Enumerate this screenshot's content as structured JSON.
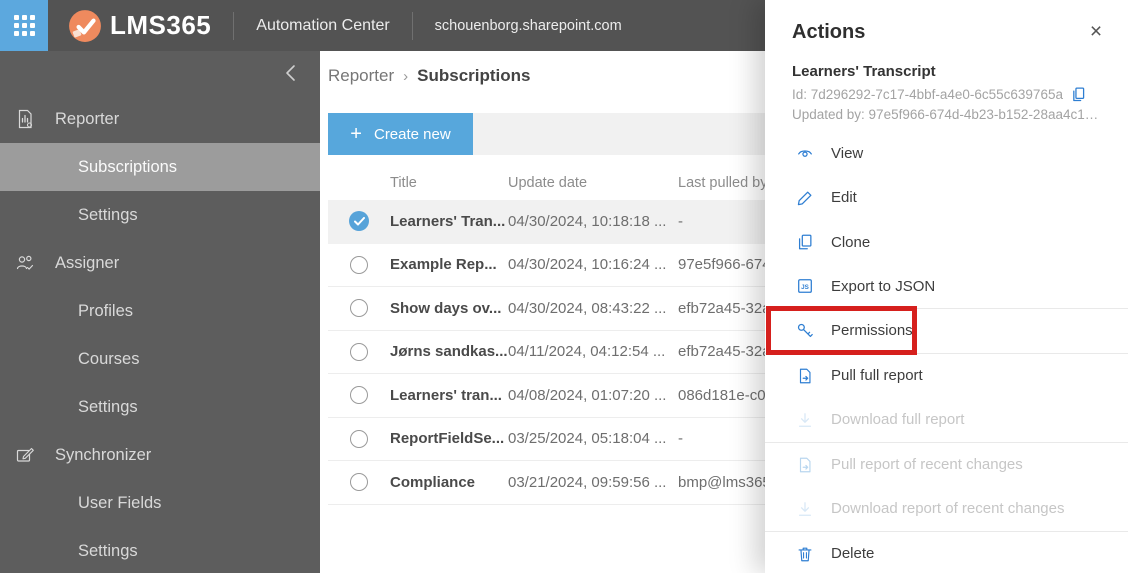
{
  "topbar": {
    "brand": "LMS365",
    "app_title": "Automation Center",
    "site_url": "schouenborg.sharepoint.com"
  },
  "sidebar": {
    "collapse_glyph": "‹",
    "items": [
      {
        "label": "Reporter",
        "type": "parent",
        "icon": "report-icon"
      },
      {
        "label": "Subscriptions",
        "type": "child",
        "selected": true
      },
      {
        "label": "Settings",
        "type": "child"
      },
      {
        "label": "Assigner",
        "type": "parent",
        "icon": "assigner-icon"
      },
      {
        "label": "Profiles",
        "type": "child"
      },
      {
        "label": "Courses",
        "type": "child"
      },
      {
        "label": "Settings",
        "type": "child"
      },
      {
        "label": "Synchronizer",
        "type": "parent",
        "icon": "synchronizer-icon"
      },
      {
        "label": "User Fields",
        "type": "child"
      },
      {
        "label": "Settings",
        "type": "child"
      }
    ]
  },
  "breadcrumb": {
    "parent": "Reporter",
    "separator": "›",
    "current": "Subscriptions"
  },
  "toolbar": {
    "plus_glyph": "+",
    "create_label": "Create new"
  },
  "table": {
    "columns": {
      "title": "Title",
      "update_date": "Update date",
      "last_pulled_by": "Last pulled by"
    },
    "rows": [
      {
        "title": "Learners' Tran...",
        "update_date": "04/30/2024, 10:18:18 ...",
        "last_pulled_by": "-",
        "selected": true
      },
      {
        "title": "Example Rep...",
        "update_date": "04/30/2024, 10:16:24 ...",
        "last_pulled_by": "97e5f966-674"
      },
      {
        "title": "Show days ov...",
        "update_date": "04/30/2024, 08:43:22 ...",
        "last_pulled_by": "efb72a45-32a"
      },
      {
        "title": "Jørns sandkas...",
        "update_date": "04/11/2024, 04:12:54 ...",
        "last_pulled_by": "efb72a45-32a"
      },
      {
        "title": "Learners' tran...",
        "update_date": "04/08/2024, 01:07:20 ...",
        "last_pulled_by": "086d181e-c05"
      },
      {
        "title": "ReportFieldSe...",
        "update_date": "03/25/2024, 05:18:04 ...",
        "last_pulled_by": "-"
      },
      {
        "title": "Compliance",
        "update_date": "03/21/2024, 09:59:56 ...",
        "last_pulled_by": "bmp@lms365"
      }
    ]
  },
  "panel": {
    "title": "Actions",
    "close_glyph": "×",
    "item_name": "Learners' Transcript",
    "id_line": "Id: 7d296292-7c17-4bbf-a4e0-6c55c639765a",
    "updated_line": "Updated by: 97e5f966-674d-4b23-b152-28aa4c1…",
    "actions": [
      {
        "label": "View",
        "icon": "view-icon",
        "enabled": true
      },
      {
        "label": "Edit",
        "icon": "edit-icon",
        "enabled": true
      },
      {
        "label": "Clone",
        "icon": "clone-icon",
        "enabled": true
      },
      {
        "label": "Export to JSON",
        "icon": "export-json-icon",
        "enabled": true
      },
      {
        "label": "Permissions",
        "icon": "key-icon",
        "enabled": true,
        "highlighted": true
      },
      {
        "label": "Pull full report",
        "icon": "pull-report-icon",
        "enabled": true
      },
      {
        "label": "Download full report",
        "icon": "download-icon",
        "enabled": false
      },
      {
        "label": "Pull report of recent changes",
        "icon": "pull-report-icon",
        "enabled": false
      },
      {
        "label": "Download report of recent changes",
        "icon": "download-icon",
        "enabled": false
      },
      {
        "label": "Delete",
        "icon": "trash-icon",
        "enabled": true
      }
    ],
    "highlight_color": "#d6201d"
  },
  "colors": {
    "topbar_bg": "#535353",
    "waffle_bg": "#5ca8de",
    "sidebar_bg": "#5d5d5d",
    "sidebar_selected_bg": "#9c9c9c",
    "accent_blue": "#57a7dc",
    "action_icon_blue": "#2e7ed2",
    "logo_orange": "#ef8a5e",
    "highlight_red": "#d6201d"
  }
}
